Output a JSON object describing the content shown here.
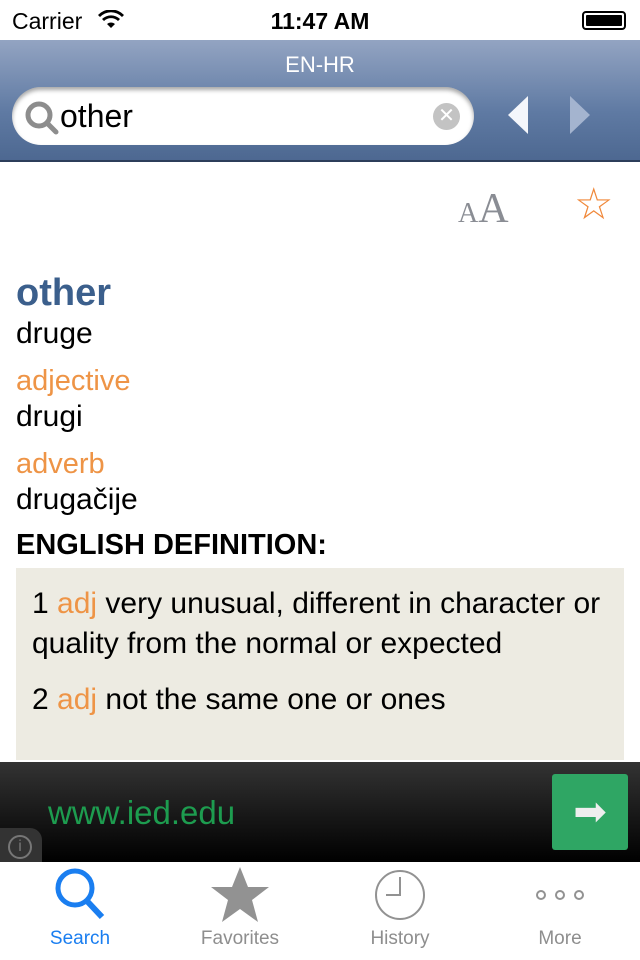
{
  "status": {
    "carrier": "Carrier",
    "time": "11:47 AM"
  },
  "nav": {
    "title": "EN-HR",
    "search_value": "other"
  },
  "entry": {
    "word": "other",
    "translation": "druge",
    "senses": [
      {
        "pos": "adjective",
        "translation": "drugi"
      },
      {
        "pos": "adverb",
        "translation": "drugačije"
      }
    ],
    "definition_header": "ENGLISH DEFINITION:",
    "definitions": [
      {
        "num": "1",
        "pos": "adj",
        "text": "very unusual, different in character or quality from the normal or expected"
      },
      {
        "num": "2",
        "pos": "adj",
        "text": "not the same one or ones"
      }
    ]
  },
  "toolbar": {
    "font_small": "A",
    "font_large": "A"
  },
  "ad": {
    "url": "www.ied.edu"
  },
  "tabs": [
    {
      "label": "Search",
      "icon": "search-icon",
      "active": true
    },
    {
      "label": "Favorites",
      "icon": "star-icon"
    },
    {
      "label": "History",
      "icon": "clock-icon"
    },
    {
      "label": "More",
      "icon": "more-icon"
    }
  ],
  "colors": {
    "accent": "#1a7ef0",
    "word": "#3b5f8c",
    "pos": "#ee9446",
    "ad_green": "#2fa664"
  }
}
